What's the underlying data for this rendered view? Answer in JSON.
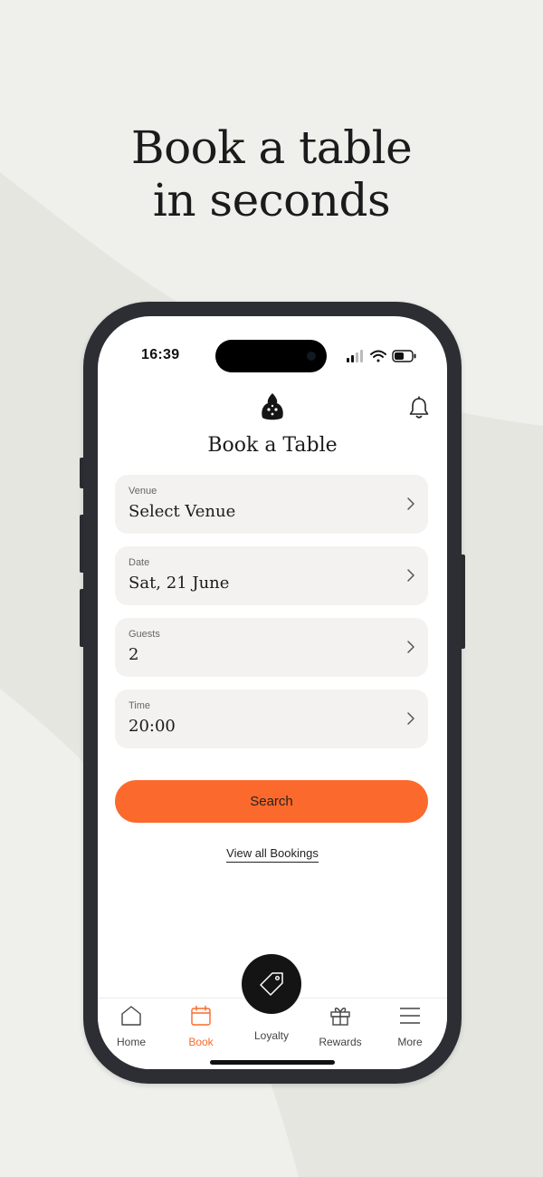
{
  "headline": {
    "line1": "Book a table",
    "line2": "in seconds"
  },
  "status_bar": {
    "time": "16:39"
  },
  "header": {
    "title": "Book a Table",
    "logo_icon": "bee-icon",
    "notification_icon": "bell-icon"
  },
  "fields": [
    {
      "label": "Venue",
      "value": "Select Venue"
    },
    {
      "label": "Date",
      "value": "Sat, 21 June"
    },
    {
      "label": "Guests",
      "value": "2"
    },
    {
      "label": "Time",
      "value": "20:00"
    }
  ],
  "search_label": "Search",
  "view_bookings_label": "View all Bookings",
  "tabs": [
    {
      "label": "Home",
      "icon": "home-icon"
    },
    {
      "label": "Book",
      "icon": "calendar-icon",
      "active": true
    },
    {
      "label": "Loyalty",
      "icon": "tag-icon"
    },
    {
      "label": "Rewards",
      "icon": "gift-icon"
    },
    {
      "label": "More",
      "icon": "menu-icon"
    }
  ],
  "colors": {
    "accent": "#fb6a2c",
    "background": "#efefec",
    "field_bg": "#f3f2f0",
    "text": "#1b1b1b"
  }
}
